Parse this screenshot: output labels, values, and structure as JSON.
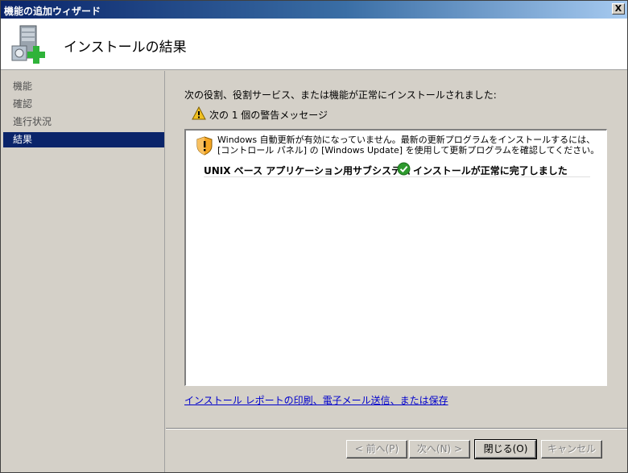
{
  "window": {
    "title": "機能の追加ウィザード",
    "close_label": "X"
  },
  "header": {
    "title": "インストールの結果",
    "icon": "server-add-icon"
  },
  "nav": {
    "items": [
      {
        "label": "機能",
        "active": false
      },
      {
        "label": "確認",
        "active": false
      },
      {
        "label": "進行状況",
        "active": false
      },
      {
        "label": "結果",
        "active": true
      }
    ]
  },
  "main": {
    "summary": "次の役割、役割サービス、または機能が正常にインストールされました:",
    "warning_count_text": "次の 1 個の警告メッセージ",
    "warning_message": "Windows 自動更新が有効になっていません。最新の更新プログラムをインストールするには、[コントロール パネル] の [Windows Update] を使用して更新プログラムを確認してください。",
    "results": [
      {
        "feature": "UNIX ベース アプリケーション用サブシステム",
        "status": "インストールが正常に完了しました",
        "status_icon": "check-circle-icon"
      }
    ],
    "report_link": "インストール レポートの印刷、電子メール送信、または保存"
  },
  "footer": {
    "prev_label": "< 前へ(P)",
    "next_label": "次へ(N) >",
    "close_label": "閉じる(O)",
    "cancel_label": "キャンセル"
  },
  "colors": {
    "titlebar": "#0a246a",
    "nav_active": "#0a246a",
    "link": "#0000cc",
    "success": "#2e9a2e",
    "warning": "#f0c020"
  }
}
